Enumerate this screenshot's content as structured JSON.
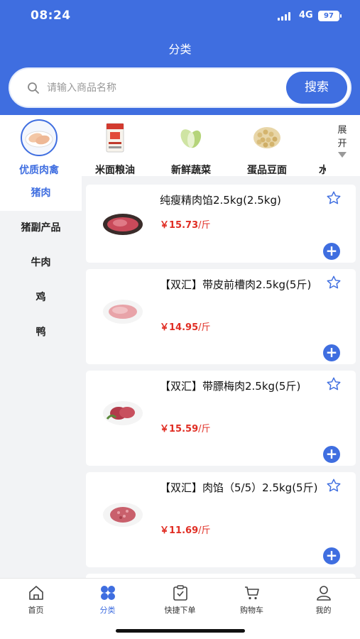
{
  "status_bar": {
    "time": "08:24",
    "network": "4G",
    "battery": "97"
  },
  "header": {
    "title": "分类"
  },
  "search": {
    "placeholder": "请输入商品名称",
    "button_label": "搜索"
  },
  "categories": [
    {
      "label": "优质肉禽",
      "icon": "chicken-meat-icon",
      "active": true
    },
    {
      "label": "米面粮油",
      "icon": "rice-bag-icon",
      "active": false
    },
    {
      "label": "新鲜蔬菜",
      "icon": "cabbage-icon",
      "active": false
    },
    {
      "label": "蛋品豆面",
      "icon": "soybeans-icon",
      "active": false
    },
    {
      "label": "水",
      "icon": "",
      "active": false
    }
  ],
  "expand": {
    "line1": "展",
    "line2": "开"
  },
  "sidebar": {
    "items": [
      {
        "label": "猪肉",
        "active": true
      },
      {
        "label": "猪副产品",
        "active": false
      },
      {
        "label": "牛肉",
        "active": false
      },
      {
        "label": "鸡",
        "active": false
      },
      {
        "label": "鸭",
        "active": false
      }
    ]
  },
  "products": [
    {
      "name": "纯瘦精肉馅2.5kg(2.5kg)",
      "price": "￥15.73",
      "unit": "/斤",
      "icon": "minced-pork-icon"
    },
    {
      "name": "【双汇】带皮前槽肉2.5kg(5斤)",
      "price": "￥14.95",
      "unit": "/斤",
      "icon": "pork-shoulder-icon"
    },
    {
      "name": "【双汇】带膘梅肉2.5kg(5斤)",
      "price": "￥15.59",
      "unit": "/斤",
      "icon": "pork-collar-icon"
    },
    {
      "name": "【双汇】肉馅（5/5）2.5kg(5斤)",
      "price": "￥11.69",
      "unit": "/斤",
      "icon": "ground-pork-icon"
    }
  ],
  "tabbar": {
    "items": [
      {
        "label": "首页",
        "icon": "home-icon",
        "active": false
      },
      {
        "label": "分类",
        "icon": "category-grid-icon",
        "active": true
      },
      {
        "label": "快捷下单",
        "icon": "clipboard-check-icon",
        "active": false
      },
      {
        "label": "购物车",
        "icon": "cart-icon",
        "active": false
      },
      {
        "label": "我的",
        "icon": "user-icon",
        "active": false
      }
    ]
  },
  "colors": {
    "primary": "#3f6ee0",
    "price": "#e02e24",
    "background": "#f2f3f5"
  }
}
